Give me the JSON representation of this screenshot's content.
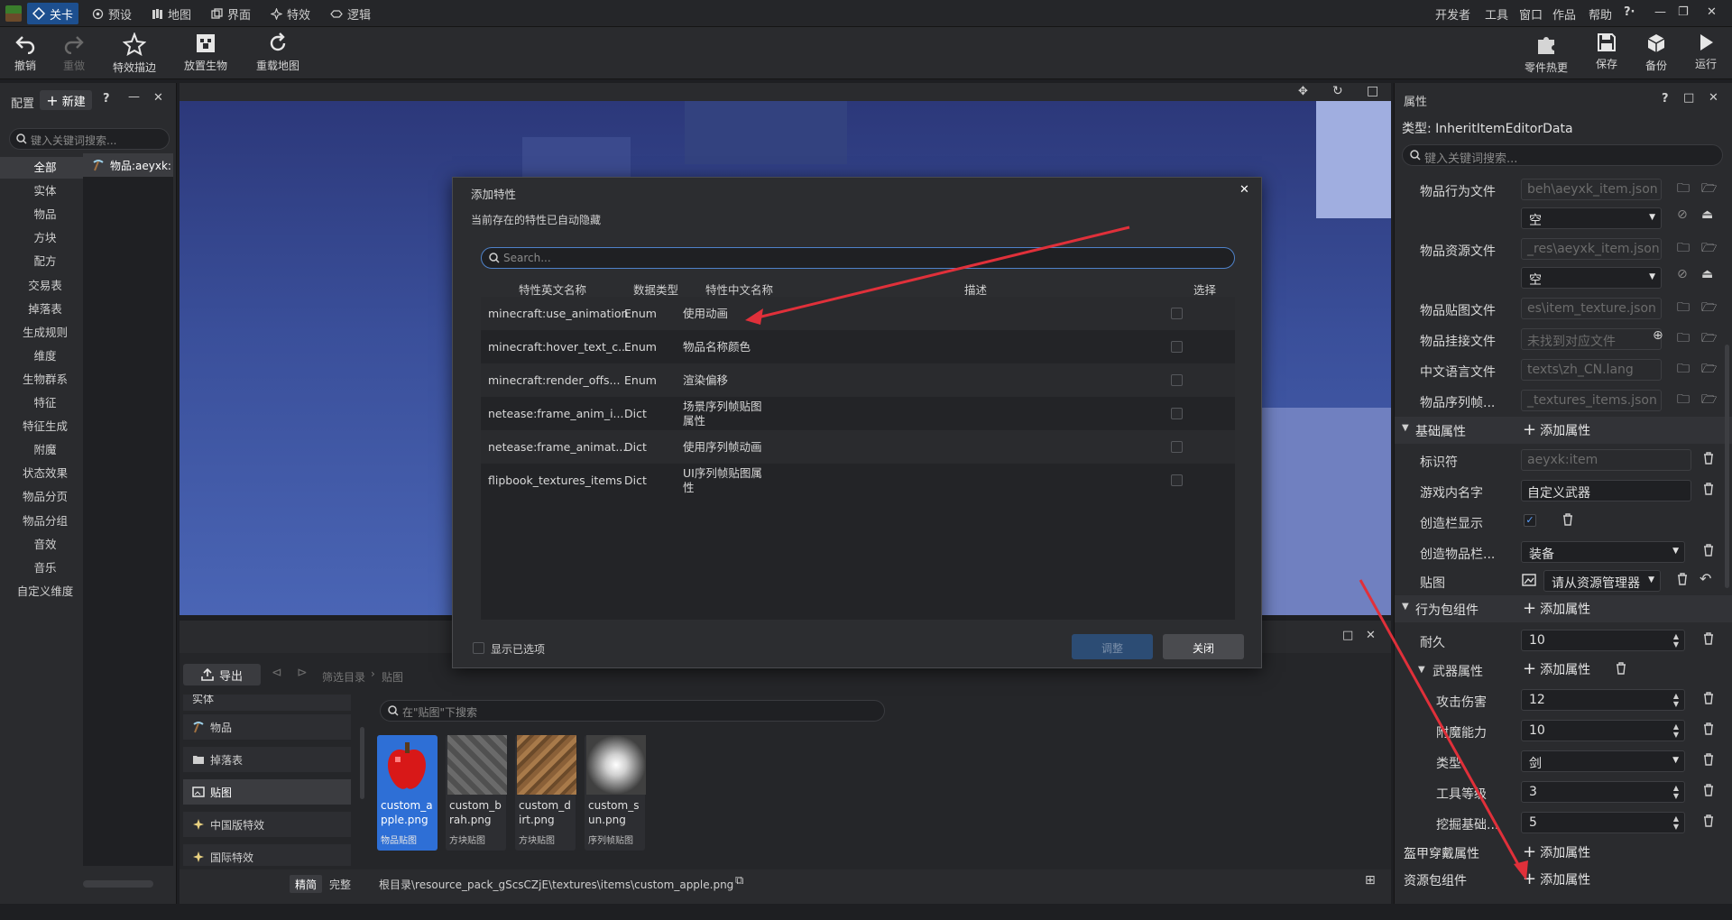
{
  "menubar": {
    "tabs": [
      {
        "label": "关卡",
        "icon": "level-icon",
        "active": true
      },
      {
        "label": "预设",
        "icon": "preset-icon"
      },
      {
        "label": "地图",
        "icon": "map-icon"
      },
      {
        "label": "界面",
        "icon": "ui-icon"
      },
      {
        "label": "特效",
        "icon": "effects-icon"
      },
      {
        "label": "逻辑",
        "icon": "logic-icon"
      }
    ],
    "right_items": [
      "开发者",
      "工具",
      "窗口",
      "作品",
      "帮助"
    ]
  },
  "toolbar": {
    "undo": "撤销",
    "redo": "重做",
    "effect_stroke": "特效描边",
    "place_creature": "放置生物",
    "reload_map": "重载地图",
    "part_hot_reload": "零件热更",
    "save": "保存",
    "backup": "备份",
    "run": "运行"
  },
  "left_panel": {
    "title": "配置",
    "new_button": "新建",
    "search_placeholder": "键入关键词搜索...",
    "categories": [
      "全部",
      "实体",
      "物品",
      "方块",
      "配方",
      "交易表",
      "掉落表",
      "生成规则",
      "维度",
      "生物群系",
      "特征",
      "特征生成",
      "附魔",
      "状态效果",
      "物品分页",
      "物品分组",
      "音效",
      "音乐",
      "自定义维度"
    ],
    "list_item": "物品:aeyxk:"
  },
  "dialog": {
    "title": "添加特性",
    "subtitle": "当前存在的特性已自动隐藏",
    "search_placeholder": "Search...",
    "columns": [
      "特性英文名称",
      "数据类型",
      "特性中文名称",
      "描述",
      "选择"
    ],
    "rows": [
      {
        "en": "minecraft:use_animation",
        "type": "Enum",
        "cn": "使用动画",
        "desc": ""
      },
      {
        "en": "minecraft:hover_text_c...",
        "type": "Enum",
        "cn": "物品名称颜色",
        "desc": ""
      },
      {
        "en": "minecraft:render_offs...",
        "type": "Enum",
        "cn": "渲染偏移",
        "desc": ""
      },
      {
        "en": "netease:frame_anim_i...",
        "type": "Dict",
        "cn": "场景序列帧贴图\n属性",
        "desc": ""
      },
      {
        "en": "netease:frame_animat...",
        "type": "Dict",
        "cn": "使用序列帧动画",
        "desc": ""
      },
      {
        "en": "flipbook_textures_items",
        "type": "Dict",
        "cn": "UI序列帧贴图属\n性",
        "desc": ""
      }
    ],
    "show_selected": "显示已选项",
    "adjust_button": "调整",
    "close_button": "关闭"
  },
  "bottom_panel": {
    "export_button": "导出",
    "breadcrumb": [
      "筛选目录",
      "贴图"
    ],
    "tree": [
      "实体",
      "物品",
      "掉落表",
      "贴图",
      "中国版特效",
      "国际特效"
    ],
    "search_placeholder": "在\"贴图\"下搜索",
    "assets": [
      {
        "name": "custom_apple.png",
        "type": "物品贴图",
        "selected": true
      },
      {
        "name": "custom_brah.png",
        "type": "方块贴图"
      },
      {
        "name": "custom_dirt.png",
        "type": "方块贴图"
      },
      {
        "name": "custom_sun.png",
        "type": "序列帧贴图"
      }
    ],
    "mode_simple": "精简",
    "mode_full": "完整",
    "path": "根目录\\resource_pack_gScsCZjE\\textures\\items\\custom_apple.png"
  },
  "properties": {
    "title": "属性",
    "type_label": "类型:  InheritItemEditorData",
    "search_placeholder": "键入关键词搜索...",
    "files": [
      {
        "label": "物品行为文件",
        "value": "beh\\aeyxk_item.json"
      },
      {
        "label": "物品资源文件",
        "value": "_res\\aeyxk_item.json"
      },
      {
        "label": "物品贴图文件",
        "value": "es\\item_texture.json"
      },
      {
        "label": "物品挂接文件",
        "value": "未找到对应文件"
      },
      {
        "label": "中文语言文件",
        "value": "texts\\zh_CN.lang"
      },
      {
        "label": "物品序列帧...",
        "value": "_textures_items.json"
      }
    ],
    "empty_select": "空",
    "basic_section": "基础属性",
    "add_property": "添加属性",
    "identifier_label": "标识符",
    "identifier_value": "aeyxk:item",
    "game_name_label": "游戏内名字",
    "game_name_value": "自定义武器",
    "creative_show_label": "创造栏显示",
    "creative_show_checked": true,
    "creative_tab_label": "创造物品栏...",
    "creative_tab_value": "装备",
    "texture_label": "贴图",
    "texture_value": "请从资源管理器",
    "behavior_section": "行为包组件",
    "durability_label": "耐久",
    "durability_value": "10",
    "weapon_section": "武器属性",
    "attack_label": "攻击伤害",
    "attack_value": "12",
    "enchant_label": "附魔能力",
    "enchant_value": "10",
    "kind_label": "类型",
    "kind_value": "剑",
    "tool_level_label": "工具等级",
    "tool_level_value": "3",
    "dig_label": "挖掘基础...",
    "dig_value": "5",
    "armor_section": "盔甲穿戴属性",
    "resource_section": "资源包组件"
  },
  "colors": {
    "accent": "#1d4f8f",
    "annotation_arrow": "#e0303a",
    "selected_asset": "#2e6fd6"
  }
}
